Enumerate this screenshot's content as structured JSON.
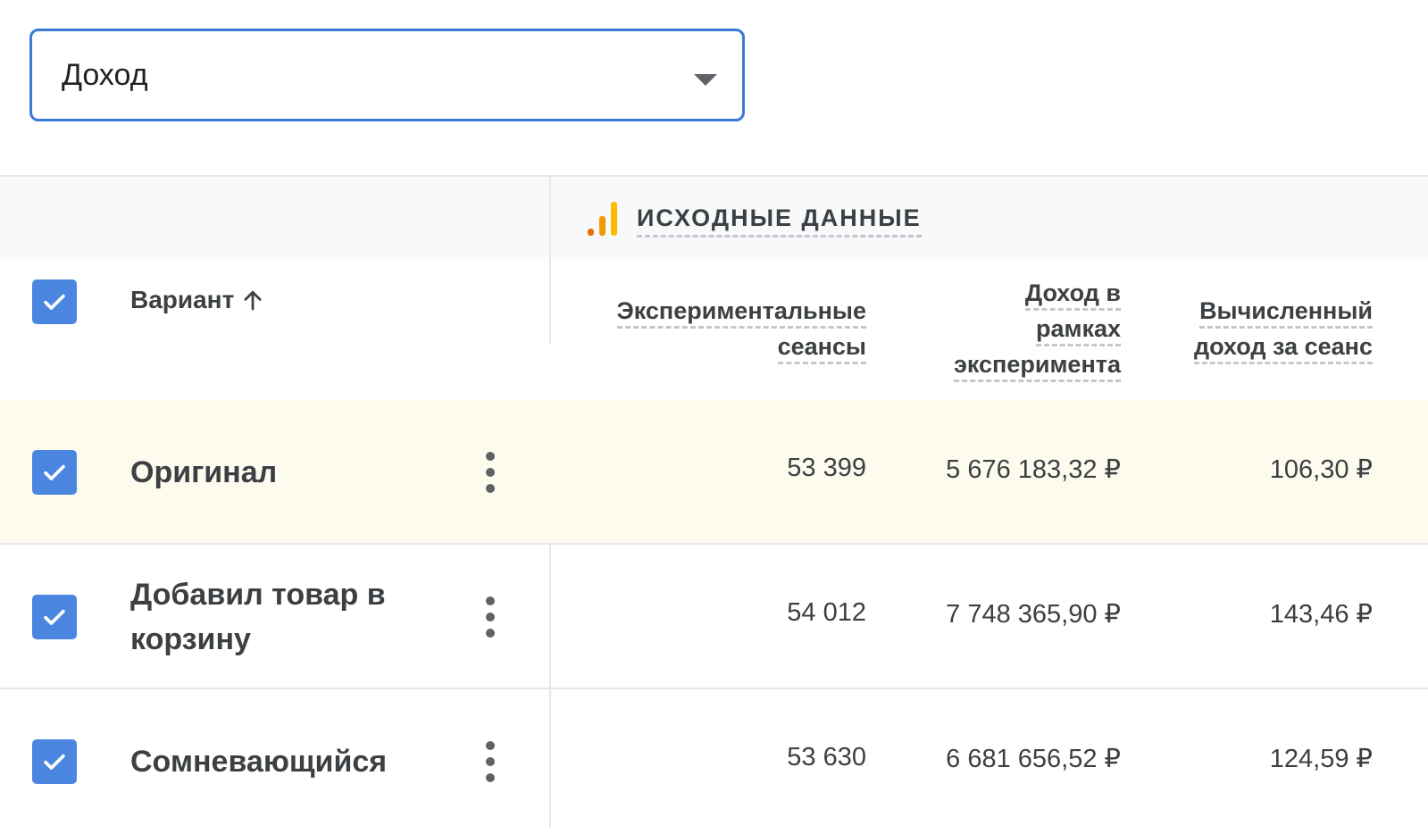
{
  "metric_select": {
    "value": "Доход"
  },
  "table": {
    "group_title": "ИСХОДНЫЕ ДАННЫЕ",
    "group_icon_colors": [
      "#e8710a",
      "#f29900",
      "#fbbc04"
    ],
    "variant_column": "Вариант",
    "columns": {
      "sessions": [
        "Экспериментальные",
        "сеансы"
      ],
      "revenue": [
        "Доход в",
        "рамках",
        "эксперимента"
      ],
      "per_session": [
        "Вычисленный",
        "доход за сеанс"
      ]
    },
    "rows": [
      {
        "name": "Оригинал",
        "sessions": "53 399",
        "revenue": "5 676 183,32 ₽",
        "per_session": "106,30 ₽",
        "checked": true
      },
      {
        "name": "Добавил товар в корзину",
        "sessions": "54 012",
        "revenue": "7 748 365,90 ₽",
        "per_session": "143,46 ₽",
        "checked": true
      },
      {
        "name": "Сомневающийся",
        "sessions": "53 630",
        "revenue": "6 681 656,52 ₽",
        "per_session": "124,59 ₽",
        "checked": true
      }
    ]
  },
  "colors": {
    "accent": "#3a78d8",
    "checkbox": "#4a86e0",
    "highlight_row": "#fdfaee"
  }
}
